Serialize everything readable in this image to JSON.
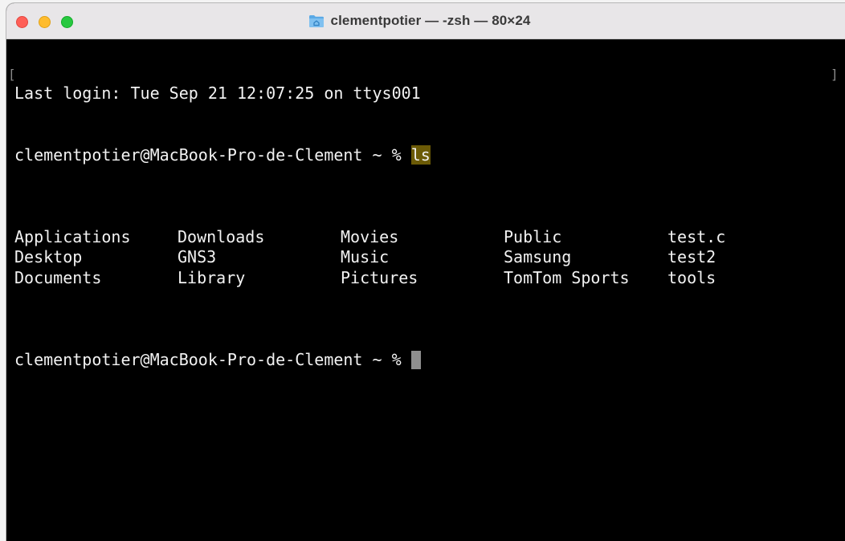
{
  "window": {
    "title": "clementpotier — -zsh — 80×24",
    "title_icon": "folder-home-icon"
  },
  "terminal": {
    "last_login": "Last login: Tue Sep 21 12:07:25 on ttys001",
    "prompt": "clementpotier@MacBook-Pro-de-Clement ~ % ",
    "command": "ls",
    "listing": [
      [
        "Applications",
        "Downloads",
        "Movies",
        "Public",
        "test.c"
      ],
      [
        "Desktop",
        "GNS3",
        "Music",
        "Samsung",
        "test2"
      ],
      [
        "Documents",
        "Library",
        "Pictures",
        "TomTom Sports",
        "tools"
      ]
    ],
    "colors": {
      "background": "#000000",
      "foreground": "#f2f2f2",
      "selection_highlight": "#6b5a06",
      "cursor": "#8f8f8f"
    }
  }
}
